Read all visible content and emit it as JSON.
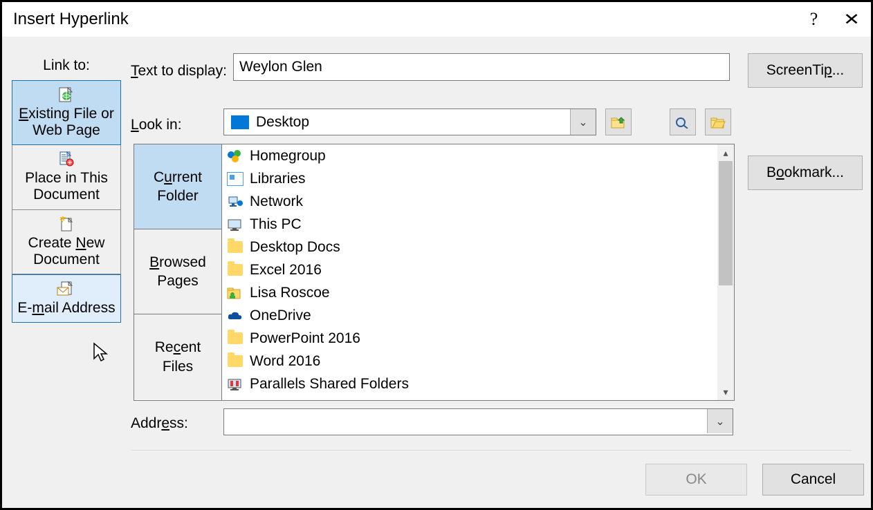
{
  "title": "Insert Hyperlink",
  "linkToLabel": "Link to:",
  "linkToItems": [
    "Existing File or Web Page",
    "Place in This Document",
    "Create New Document",
    "E-mail Address"
  ],
  "textToDisplayLabel": "Text to display:",
  "textToDisplay": "Weylon Glen",
  "screentipLabel": "ScreenTip...",
  "lookInLabel": "Look in:",
  "lookIn": "Desktop",
  "bookmarkLabel": "Bookmark...",
  "browseTabs": {
    "current": "Current Folder",
    "browsed": "Browsed Pages",
    "recent": "Recent Files"
  },
  "files": [
    "Homegroup",
    "Libraries",
    "Network",
    "This PC",
    "Desktop Docs",
    "Excel 2016",
    "Lisa Roscoe",
    "OneDrive",
    "PowerPoint 2016",
    "Word 2016",
    "Parallels Shared Folders"
  ],
  "addressLabel": "Address:",
  "address": "",
  "buttons": {
    "ok": "OK",
    "cancel": "Cancel"
  }
}
